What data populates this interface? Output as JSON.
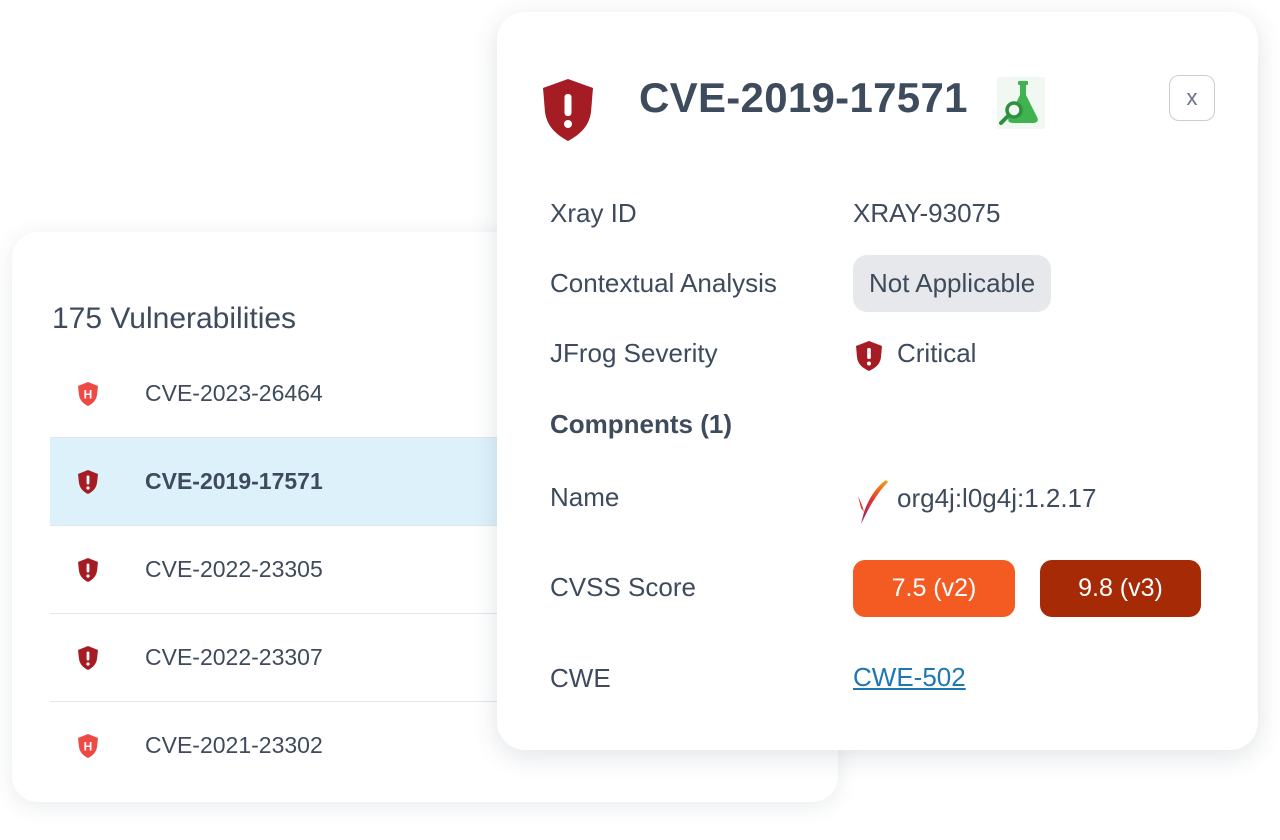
{
  "list": {
    "title": "175 Vulnerabilities",
    "items": [
      {
        "cve": "CVE-2023-26464",
        "severity": "high"
      },
      {
        "cve": "CVE-2019-17571",
        "severity": "critical",
        "selected": true
      },
      {
        "cve": "CVE-2022-23305",
        "severity": "critical"
      },
      {
        "cve": "CVE-2022-23307",
        "severity": "critical"
      },
      {
        "cve": "CVE-2021-23302",
        "severity": "high"
      }
    ]
  },
  "detail": {
    "title": "CVE-2019-17571",
    "close_label": "x",
    "xray_id_label": "Xray ID",
    "xray_id_value": "XRAY-93075",
    "contextual_label": "Contextual Analysis",
    "contextual_value": "Not Applicable",
    "severity_label": "JFrog Severity",
    "severity_value": "Critical",
    "components_label": "Compnents (1)",
    "name_label": "Name",
    "name_value": "org4j:l0g4j:1.2.17",
    "cvss_label": "CVSS Score",
    "cvss_v2": "7.5 (v2)",
    "cvss_v3": "9.8 (v3)",
    "cwe_label": "CWE",
    "cwe_value": "CWE-502"
  },
  "icons": {
    "critical": "shield-exclamation-icon",
    "high": "shield-h-icon",
    "research": "flask-magnifier-icon",
    "component": "apache-feather-icon"
  },
  "colors": {
    "critical": "#a51c24",
    "high": "#ee4a45",
    "selected_row": "#ddf1fb",
    "cvss_v2": "#f35b22",
    "cvss_v3": "#a52a05",
    "research": "#3fb34f",
    "link": "#1d77b5"
  }
}
